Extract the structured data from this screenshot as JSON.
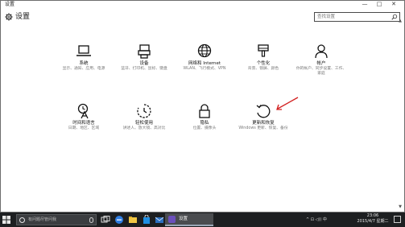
{
  "window": {
    "title": "设置",
    "minimize_glyph": "—",
    "maximize_glyph": "□",
    "close_glyph": "✕"
  },
  "header": {
    "page_title": "设置",
    "icon": "gear-icon"
  },
  "search": {
    "placeholder": "查找设置",
    "icon": "search-icon"
  },
  "tiles": [
    {
      "name": "系统",
      "desc": "显示、通知、应用、电源",
      "icon": "laptop-icon"
    },
    {
      "name": "设备",
      "desc": "蓝牙、打印机、鼠标、键盘",
      "icon": "devices-icon"
    },
    {
      "name": "网络和 Internet",
      "desc": "WLAN、飞行模式、VPN",
      "icon": "globe-icon"
    },
    {
      "name": "个性化",
      "desc": "背景、锁屏、颜色",
      "icon": "paintbrush-icon"
    },
    {
      "name": "帐户",
      "desc": "你的帐户、同步设置、工作、家庭",
      "icon": "person-icon"
    },
    {
      "name": "时间和语言",
      "desc": "日期、地区、区域",
      "icon": "time-language-icon"
    },
    {
      "name": "轻松使用",
      "desc": "讲述人、放大镜、高对比",
      "icon": "ease-of-access-icon"
    },
    {
      "name": "隐私",
      "desc": "位置、摄像头",
      "icon": "lock-icon"
    },
    {
      "name": "更新和恢复",
      "desc": "Windows 更新、恢复、备份",
      "icon": "refresh-icon"
    }
  ],
  "annotation": {
    "color": "#d21f1f",
    "icon": "red-arrow"
  },
  "taskbar": {
    "search_placeholder": "有问题尽管问我",
    "app_label": "设置",
    "tray_text": "^ ⊡ ◁)) 中",
    "clock_time": "23:06",
    "clock_date": "2015/4/7 星期二",
    "background": "#1d1f21"
  }
}
